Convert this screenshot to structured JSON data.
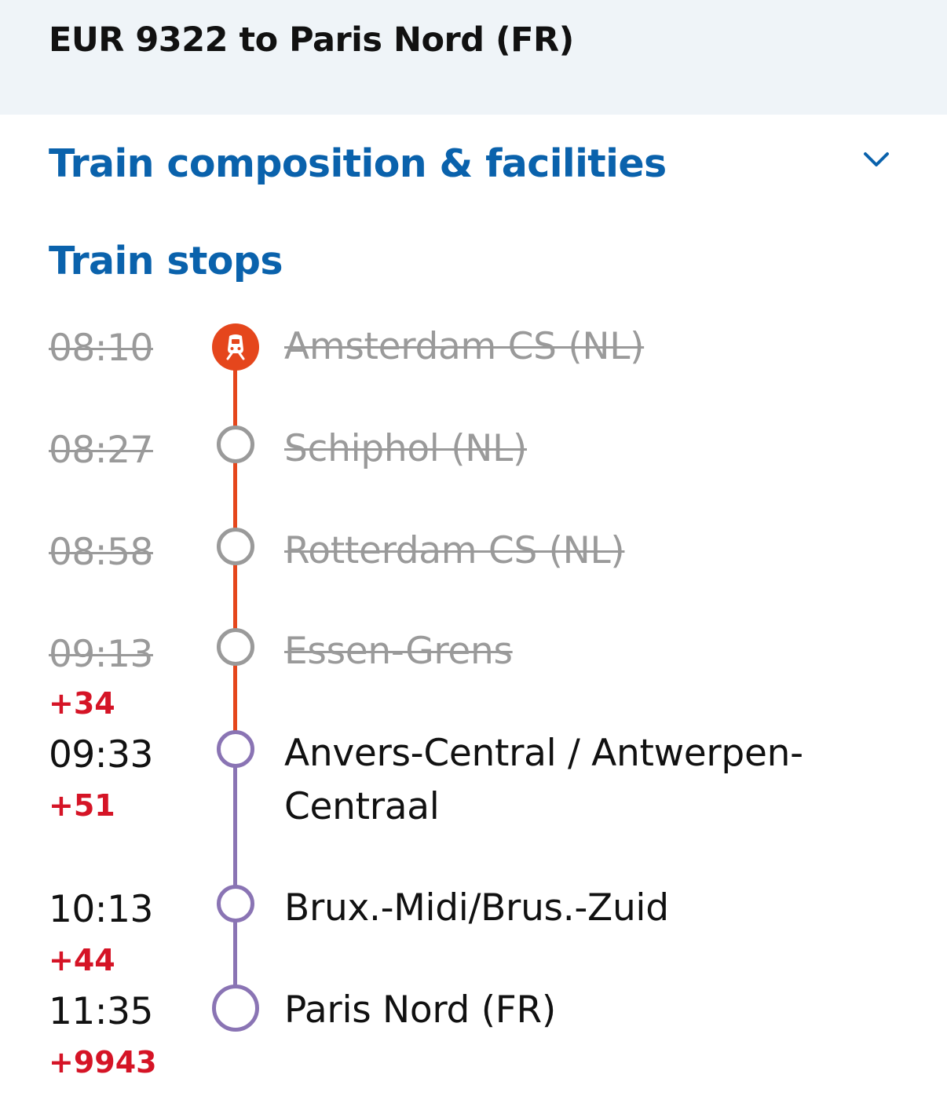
{
  "header": {
    "title": "EUR 9322 to Paris Nord (FR)"
  },
  "composition": {
    "title": "Train composition & facilities",
    "icon": "chevron-down-icon"
  },
  "stops_section": {
    "title": "Train stops"
  },
  "stops": [
    {
      "time": "08:10",
      "delay": "",
      "station": "Amsterdam CS (NL)",
      "status": "passed",
      "marker": "train-icon"
    },
    {
      "time": "08:27",
      "delay": "",
      "station": "Schiphol (NL)",
      "status": "passed"
    },
    {
      "time": "08:58",
      "delay": "",
      "station": "Rotterdam CS (NL)",
      "status": "passed"
    },
    {
      "time": "09:13",
      "delay": "+34",
      "station": "Essen-Grens",
      "status": "passed"
    },
    {
      "time": "09:33",
      "delay": "+51",
      "station": "Anvers-Central / Antwerpen-Centraal",
      "status": "upcoming"
    },
    {
      "time": "10:13",
      "delay": "+44",
      "station": "Brux.-Midi/Brus.-Zuid",
      "status": "upcoming"
    },
    {
      "time": "11:35",
      "delay": "+9943",
      "station": "Paris Nord (FR)",
      "status": "destination"
    }
  ],
  "colors": {
    "header_bg": "#eff4f8",
    "link_blue": "#0a62ac",
    "delay_red": "#d51426",
    "travelled_line": "#e5461c",
    "upcoming_line": "#8a74b4",
    "passed_grey": "#9a9a9a"
  }
}
